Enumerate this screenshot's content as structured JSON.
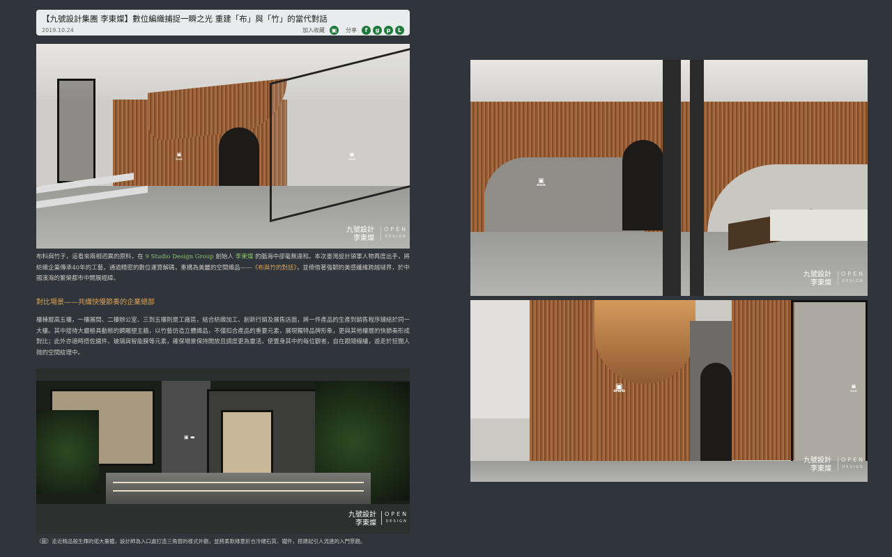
{
  "header": {
    "title": "【九號設計集團 李東燦】數位編織捕捉一瞬之光 重建「布」與「竹」的當代對話",
    "date": "2019.10.24",
    "favorite_label": "加入收藏",
    "share_label": "分享",
    "icons": [
      "bookmark-icon",
      "facebook-icon",
      "googleplus-icon",
      "pinterest-icon",
      "line-icon"
    ]
  },
  "watermark": {
    "brand": "九號設計",
    "designer": "李東燦",
    "open": "OPEN",
    "design": "DESIGN"
  },
  "article": {
    "p1_a": "布料與竹子，這看來兩相迥異的原料，在 ",
    "p1_studio": "9 Studio Design Group",
    "p1_b": " 創始人 ",
    "p1_name": "李東燦",
    "p1_c": " 的腦海中卻毫無違和。本次臺灣設計領軍人物再度出手，將紡織企業傳承40年的工藝，通過精密的數位運算解碼，重構為美麗的空間織品——",
    "p1_work": "《布與竹的對話》",
    "p1_d": "，並倚借著強韌的美感纖維跨越縫界，於中國濱海的繁榮都市中開展經緯。",
    "heading": "對比場景——共織快慢節奏的企業總部",
    "p2": "樓棟層高五樓，一樓展間、二樓辦公室、三到五樓則是工廠區，結合紡織加工、創新行銷及展售店面，將一件產品的生產到銷售程序鏈結於同一大樓。其中接待大廳極具動態的鋼雕塑主牆，以竹藝仿造立體織品，不僅扣合產品的重要元素，展現獨特品牌形象，更與其他樓層的快節奏形成對比；此外亦適時搭佐鐵件、玻璃與智能膜等元素，確保場景保持開放且調度更為靈活，使置身其中的每位觀者，自在跟隨線縷，遊走於狂闊人微的空間紋理中。",
    "caption": "（圖）走近精品般生輝的偌大量體，設計師為入口處打造三角窗的樣式外觀，並將柔軟綠意折合冷硬石質、鐵件，搭建起引人流連的入門景觀。"
  },
  "colors": {
    "background": "#2f353a",
    "header_bg": "#e9ecec",
    "accent_green": "#8fc36e",
    "accent_orange": "#d7a15a",
    "icon_green": "#1e7a3c"
  }
}
